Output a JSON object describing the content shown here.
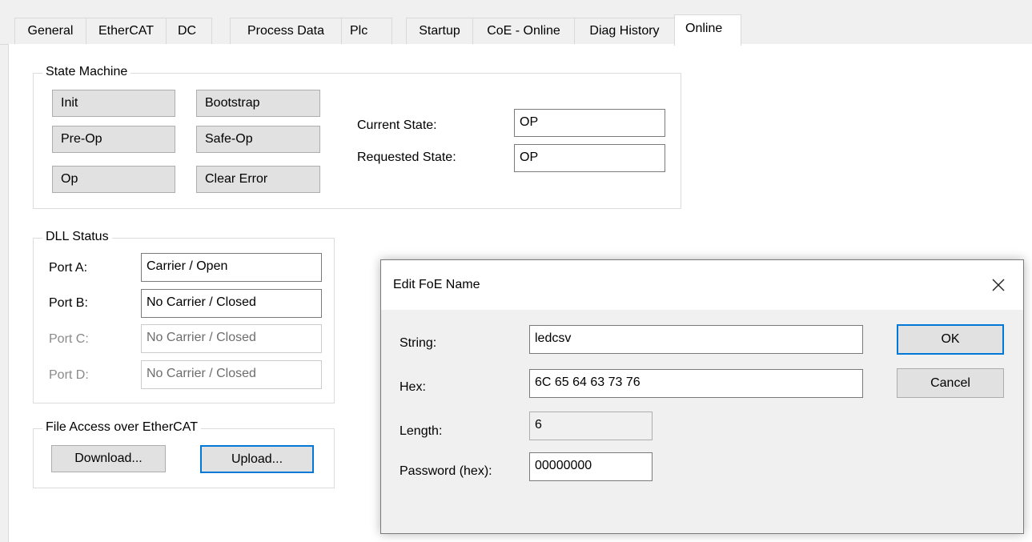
{
  "tabs": [
    {
      "label": "General"
    },
    {
      "label": "EtherCAT"
    },
    {
      "label": "DC"
    },
    {
      "label": "Process Data"
    },
    {
      "label": "Plc"
    },
    {
      "label": "Startup"
    },
    {
      "label": "CoE - Online"
    },
    {
      "label": "Diag History"
    },
    {
      "label": "Online"
    }
  ],
  "state_machine": {
    "title": "State Machine",
    "buttons": {
      "init": "Init",
      "bootstrap": "Bootstrap",
      "pre_op": "Pre-Op",
      "safe_op": "Safe-Op",
      "op": "Op",
      "clear_error": "Clear Error"
    },
    "current_state_label": "Current State:",
    "current_state_value": "OP",
    "requested_state_label": "Requested State:",
    "requested_state_value": "OP"
  },
  "dll_status": {
    "title": "DLL Status",
    "ports": [
      {
        "label": "Port A:",
        "value": "Carrier / Open"
      },
      {
        "label": "Port B:",
        "value": "No Carrier / Closed"
      },
      {
        "label": "Port C:",
        "value": "No Carrier / Closed"
      },
      {
        "label": "Port D:",
        "value": "No Carrier / Closed"
      }
    ]
  },
  "foe": {
    "title": "File Access over EtherCAT",
    "download_label": "Download...",
    "upload_label": "Upload..."
  },
  "dialog": {
    "title": "Edit FoE Name",
    "close_icon": "close-icon",
    "string_label": "String:",
    "string_value": "ledcsv",
    "hex_label": "Hex:",
    "hex_value": "6C 65 64 63 73 76",
    "length_label": "Length:",
    "length_value": "6",
    "password_label": "Password (hex):",
    "password_value": "00000000",
    "ok_label": "OK",
    "cancel_label": "Cancel"
  },
  "colors": {
    "focus_blue": "#0078d7",
    "button_face": "#e1e1e1"
  }
}
